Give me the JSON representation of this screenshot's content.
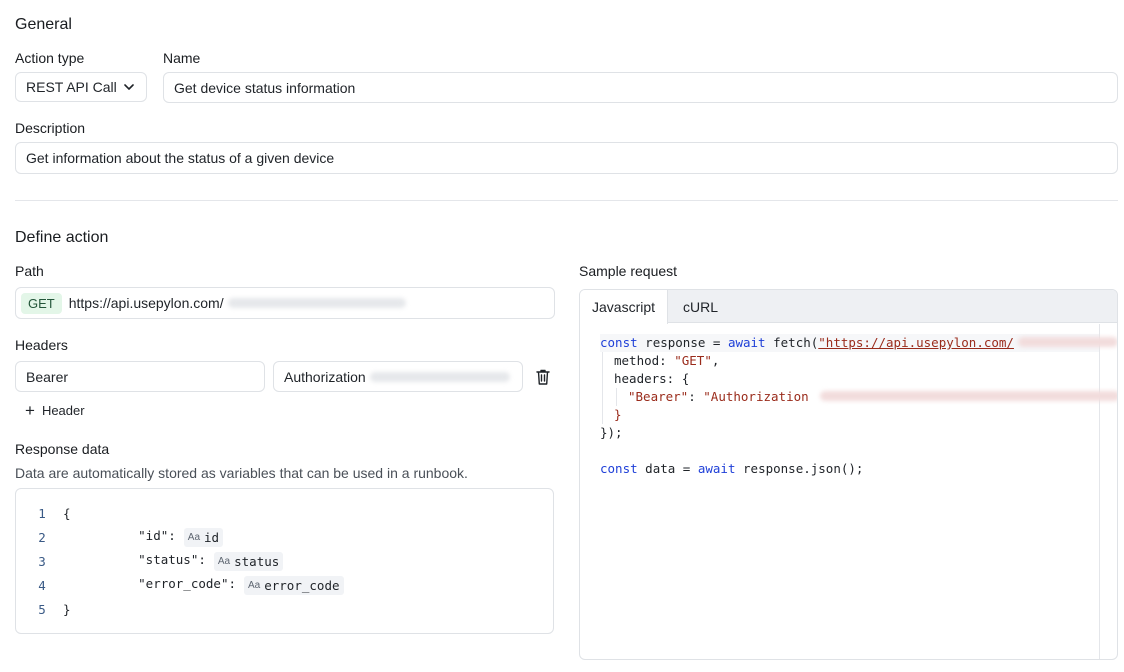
{
  "general": {
    "heading": "General",
    "action_type_label": "Action type",
    "action_type_value": "REST API Call",
    "name_label": "Name",
    "name_value": "Get device status information",
    "description_label": "Description",
    "description_value": "Get information about the status of a given device"
  },
  "define": {
    "heading": "Define action",
    "path_label": "Path",
    "method": "GET",
    "path_value": "https://api.usepylon.com/",
    "headers_label": "Headers",
    "header_key": "Bearer",
    "header_value": "Authorization",
    "add_header_label": "Header",
    "response_label": "Response data",
    "response_description": "Data are automatically stored as variables that can be used in a runbook.",
    "response_lines": [
      {
        "num": "1",
        "text": "{"
      },
      {
        "num": "2",
        "text": "\"id\":",
        "var_prefix": "Aa",
        "var": "id"
      },
      {
        "num": "3",
        "text": "\"status\":",
        "var_prefix": "Aa",
        "var": "status"
      },
      {
        "num": "4",
        "text": "\"error_code\":",
        "var_prefix": "Aa",
        "var": "error_code"
      },
      {
        "num": "5",
        "text": "}"
      }
    ]
  },
  "sample": {
    "label": "Sample request",
    "tabs": [
      "Javascript",
      "cURL"
    ],
    "code": {
      "l1_kw1": "const",
      "l1_a": " response = ",
      "l1_kw2": "await",
      "l1_b": " fetch(",
      "l1_url": "\"https://api.usepylon.com/",
      "l2_a": "method: ",
      "l2_str": "\"GET\"",
      "l2_b": ",",
      "l3": "headers: {",
      "l4_key": "\"Bearer\"",
      "l4_colon": ": ",
      "l4_val": "\"Authorization ",
      "l5": "}",
      "l6": "});",
      "l8_kw1": "const",
      "l8_a": " data = ",
      "l8_kw2": "await",
      "l8_b": " response.json();"
    }
  },
  "colors": {
    "keyword": "#1e3fd8",
    "string": "#9a2b1b",
    "get_badge_bg": "#e3f6e8",
    "border": "#dfe2e6"
  },
  "icons": [
    "chevron-down-icon",
    "trash-icon",
    "plus-icon",
    "text-type-icon"
  ]
}
